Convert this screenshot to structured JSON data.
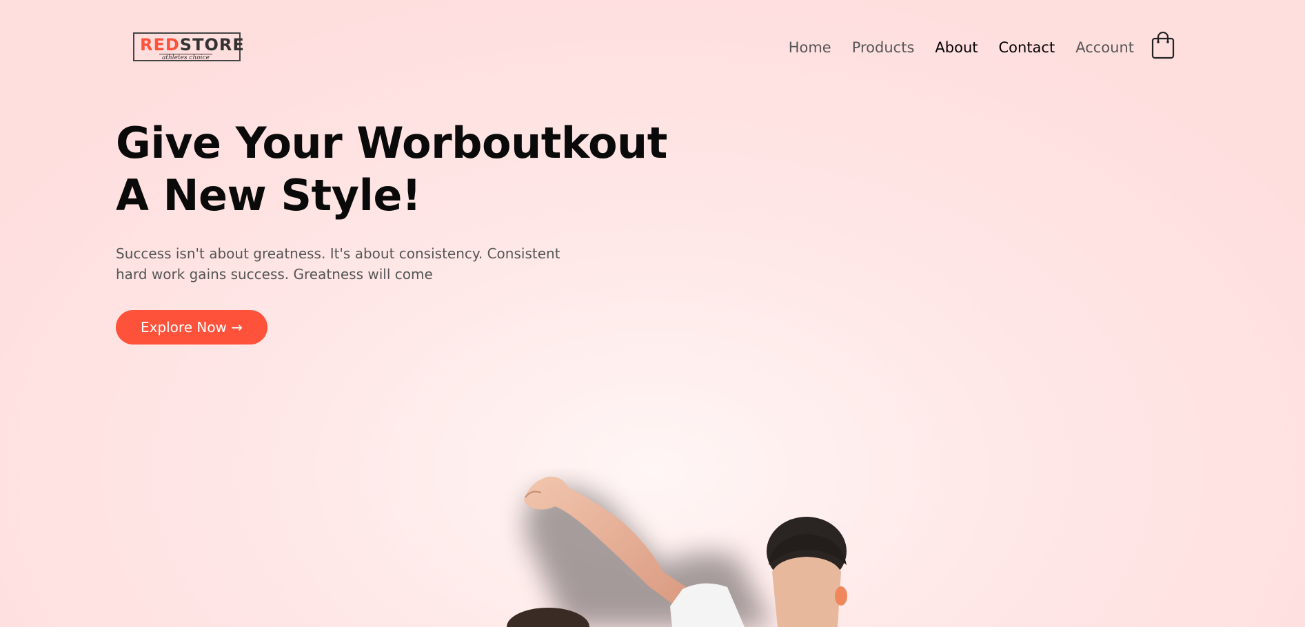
{
  "brand": {
    "logo_part1": "RED",
    "logo_part2": "STORE",
    "tagline": "athletes choice",
    "accent": "#ff523b"
  },
  "nav": {
    "items": [
      {
        "label": "Home"
      },
      {
        "label": "Products"
      },
      {
        "label": "About"
      },
      {
        "label": "Contact"
      },
      {
        "label": "Account"
      }
    ],
    "cart_icon": "shopping-bag-icon"
  },
  "hero": {
    "title_line1": "Give Your Worboutkout",
    "title_line2": "A New Style!",
    "text_line1": "Success isn't about greatness. It's about consistency. Consistent",
    "text_line2": "hard work gains success. Greatness will come",
    "cta_label": "Explore Now →",
    "image": "man-flexing-arm-photo"
  }
}
